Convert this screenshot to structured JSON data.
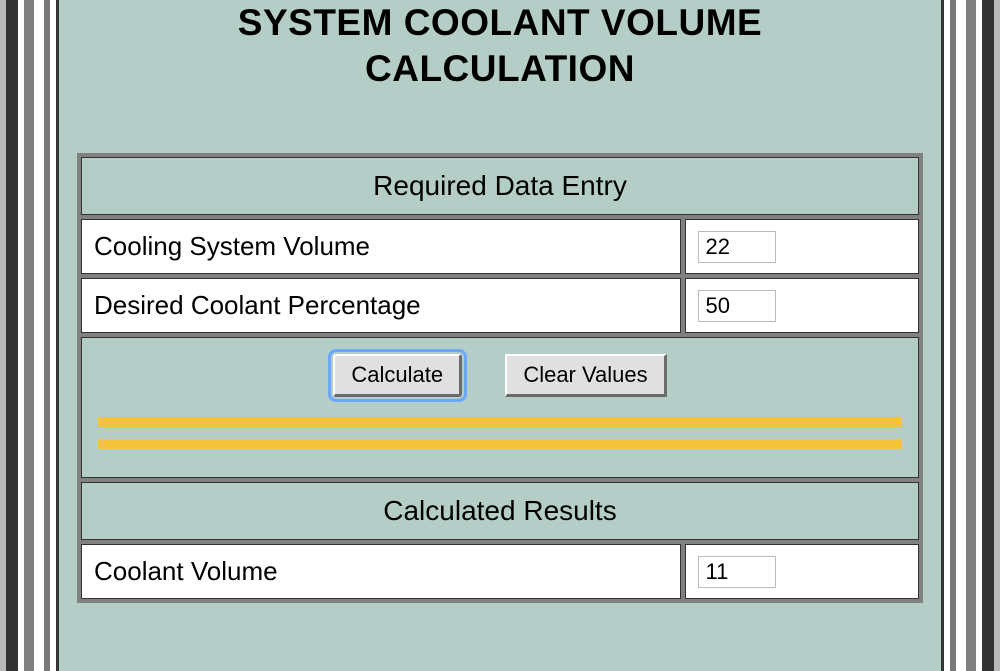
{
  "title_line1": "SYSTEM COOLANT VOLUME",
  "title_line2": "CALCULATION",
  "sections": {
    "entry_header": "Required Data Entry",
    "results_header": "Calculated Results"
  },
  "inputs": {
    "cooling_system_volume": {
      "label": "Cooling System Volume",
      "value": "22"
    },
    "desired_coolant_percentage": {
      "label": "Desired Coolant Percentage",
      "value": "50"
    }
  },
  "buttons": {
    "calculate": "Calculate",
    "clear": "Clear Values"
  },
  "results": {
    "coolant_volume": {
      "label": "Coolant Volume",
      "value": "11"
    }
  }
}
